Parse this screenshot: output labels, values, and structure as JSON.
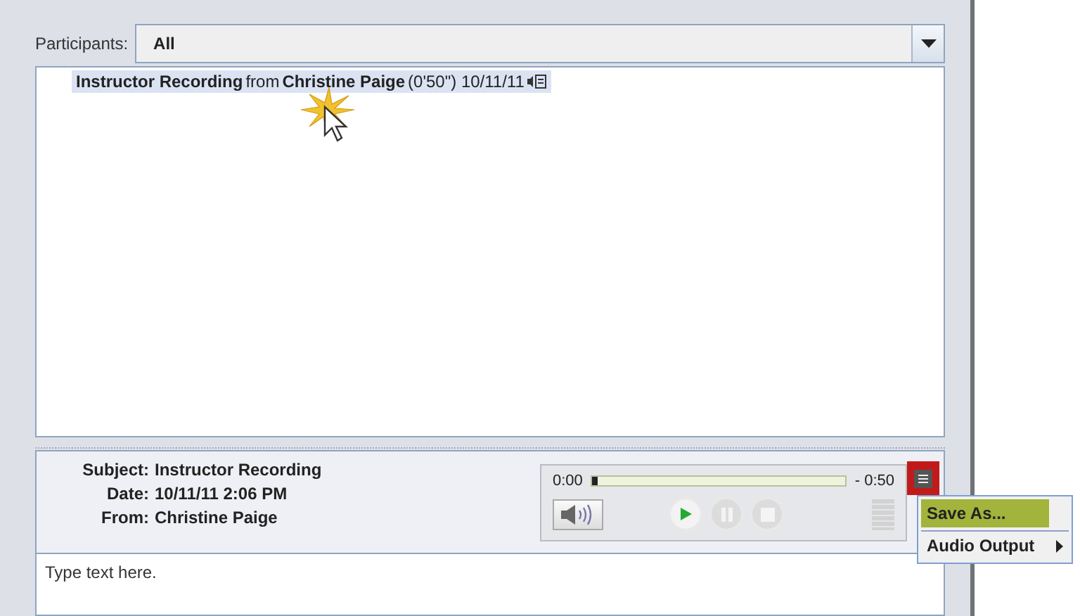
{
  "participants": {
    "label": "Participants:",
    "value": "All"
  },
  "recordings": [
    {
      "text": "**Instructor Recording** from **Christine Paige** (0'50\") 10/11/11",
      "selected": true
    }
  ],
  "details": [
    {
      "label": "Subject:",
      "value": "Instructor Recording"
    },
    {
      "label": "Date:",
      "value": "10/11/11 2:06 PM"
    },
    {
      "label": "From:",
      "value": "Christine Paige"
    }
  ],
  "player": {
    "elapsed": "0:00",
    "remaining": "- 0:50",
    "level": 0.02,
    "play_enabled": true,
    "pause_enabled": false,
    "stop_enabled": false
  },
  "menu": [
    {
      "label": "Save As...",
      "selected": true,
      "submenu": false
    },
    {
      "label": "Audio Output",
      "selected": false,
      "submenu": true
    }
  ],
  "message": {
    "placeholder": "Type text here."
  }
}
